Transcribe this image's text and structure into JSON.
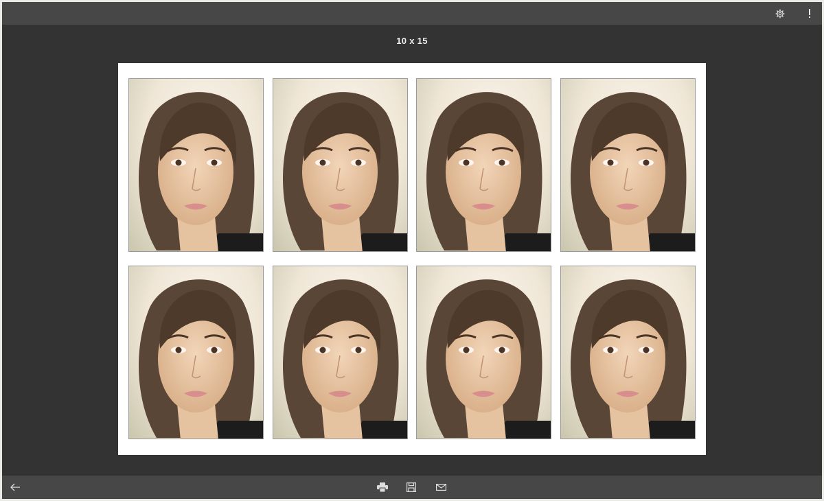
{
  "header": {
    "settings_icon": "gear-icon",
    "feedback_icon": "exclamation-icon"
  },
  "title": "10 x 15",
  "sheet": {
    "rows": 2,
    "columns": 4,
    "photo_count": 8
  },
  "toolbar": {
    "back_icon": "arrow-left-icon",
    "print_icon": "printer-icon",
    "save_icon": "save-icon",
    "mail_icon": "mail-icon"
  },
  "colors": {
    "window_bg": "#333333",
    "bar_bg": "#474747",
    "sheet_bg": "#ffffff",
    "icon": "#dddddd"
  }
}
